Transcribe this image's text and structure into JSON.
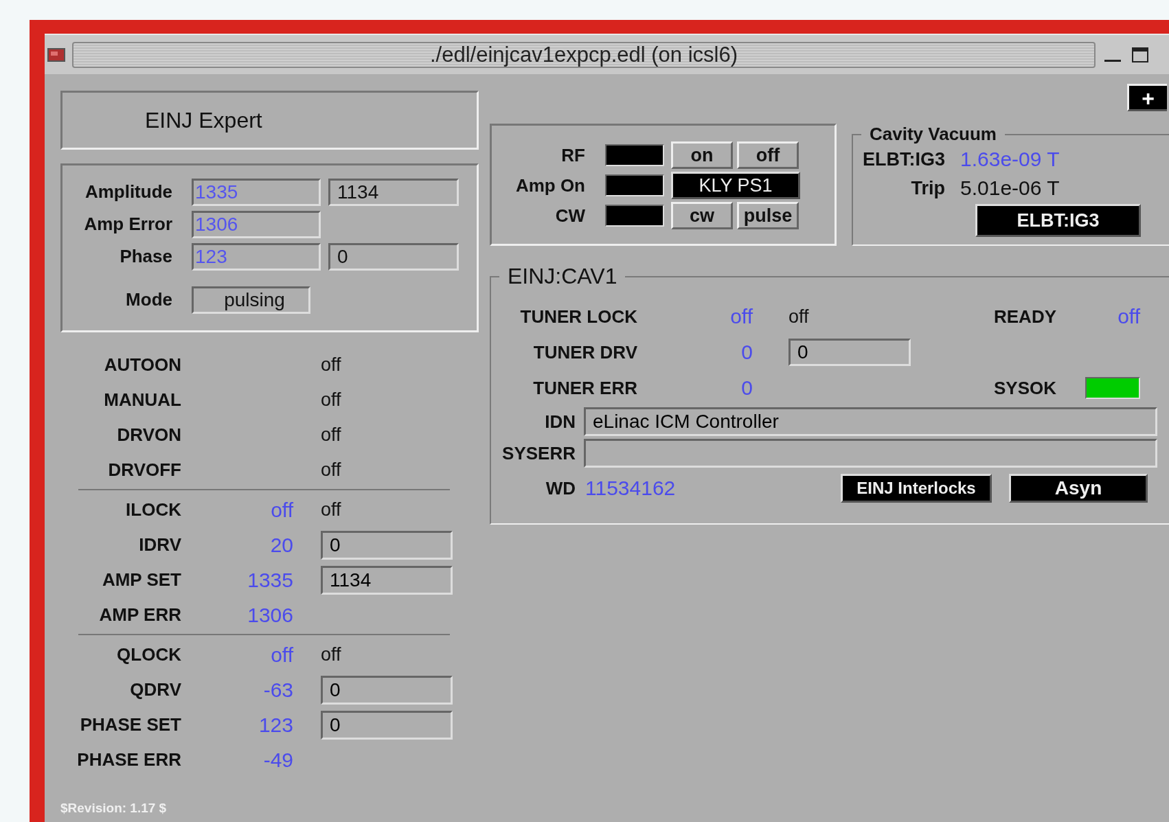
{
  "window": {
    "title": "./edl/einjcav1expcp.edl (on icsl6)"
  },
  "header": {
    "title": "EINJ Expert"
  },
  "settings": [
    {
      "kind": "readback-setpoint",
      "label": "Amplitude",
      "readback": "1335",
      "setpoint": "1134"
    },
    {
      "kind": "readback",
      "label": "Amp Error",
      "readback": "1306"
    },
    {
      "kind": "readback-setpoint",
      "label": "Phase",
      "readback": "123",
      "setpoint": "0"
    },
    {
      "kind": "status",
      "label": "Mode",
      "value": "pulsing"
    }
  ],
  "status_groups": [
    {
      "rows": [
        {
          "label": "AUTOON",
          "state": "off"
        },
        {
          "label": "MANUAL",
          "state": "off"
        },
        {
          "label": "DRVON",
          "state": "off"
        },
        {
          "label": "DRVOFF",
          "state": "off"
        }
      ]
    },
    {
      "rows": [
        {
          "label": "ILOCK",
          "readback": "off",
          "state": "off"
        },
        {
          "label": "IDRV",
          "readback": "20",
          "setpoint": "0"
        },
        {
          "label": "AMP SET",
          "readback": "1335",
          "setpoint": "1134"
        },
        {
          "label": "AMP ERR",
          "readback": "1306"
        }
      ]
    },
    {
      "rows": [
        {
          "label": "QLOCK",
          "readback": "off",
          "state": "off"
        },
        {
          "label": "QDRV",
          "readback": "-63",
          "setpoint": "0"
        },
        {
          "label": "PHASE SET",
          "readback": "123",
          "setpoint": "0"
        },
        {
          "label": "PHASE ERR",
          "readback": "-49"
        }
      ]
    }
  ],
  "rf_controls": [
    {
      "label": "RF",
      "on": false,
      "buttons": [
        {
          "kind": "push",
          "label": "on"
        },
        {
          "kind": "push",
          "label": "off"
        }
      ]
    },
    {
      "label": "Amp On",
      "on": false,
      "buttons": [
        {
          "kind": "related",
          "label": "KLY PS1"
        }
      ]
    },
    {
      "label": "CW",
      "on": false,
      "buttons": [
        {
          "kind": "push",
          "label": "cw"
        },
        {
          "kind": "push",
          "label": "pulse"
        }
      ]
    }
  ],
  "cavity_vacuum": {
    "title": "Cavity Vacuum",
    "rows": [
      {
        "kind": "readback",
        "label": "ELBT:IG3",
        "value": "1.63e-09 T"
      },
      {
        "kind": "limit",
        "label": "Trip",
        "value": "5.01e-06 T"
      }
    ],
    "button": "ELBT:IG3"
  },
  "plus_button": "+",
  "cav1": {
    "title": "EINJ:CAV1",
    "rows": [
      {
        "label": "TUNER LOCK",
        "readback": "off",
        "state": "off",
        "right_label": "READY",
        "right_value": "off"
      },
      {
        "label": "TUNER DRV",
        "readback": "0",
        "setpoint": "0"
      },
      {
        "label": "TUNER ERR",
        "readback": "0",
        "right_label": "SYSOK",
        "right_led_on": true
      }
    ],
    "idn": {
      "label": "IDN",
      "value": "eLinac ICM Controller"
    },
    "syserr": {
      "label": "SYSERR"
    },
    "wd": {
      "label": "WD",
      "value": "11534162"
    },
    "buttons": [
      "EINJ Interlocks",
      "Asyn"
    ]
  },
  "revision": "$Revision: 1.17 $"
}
